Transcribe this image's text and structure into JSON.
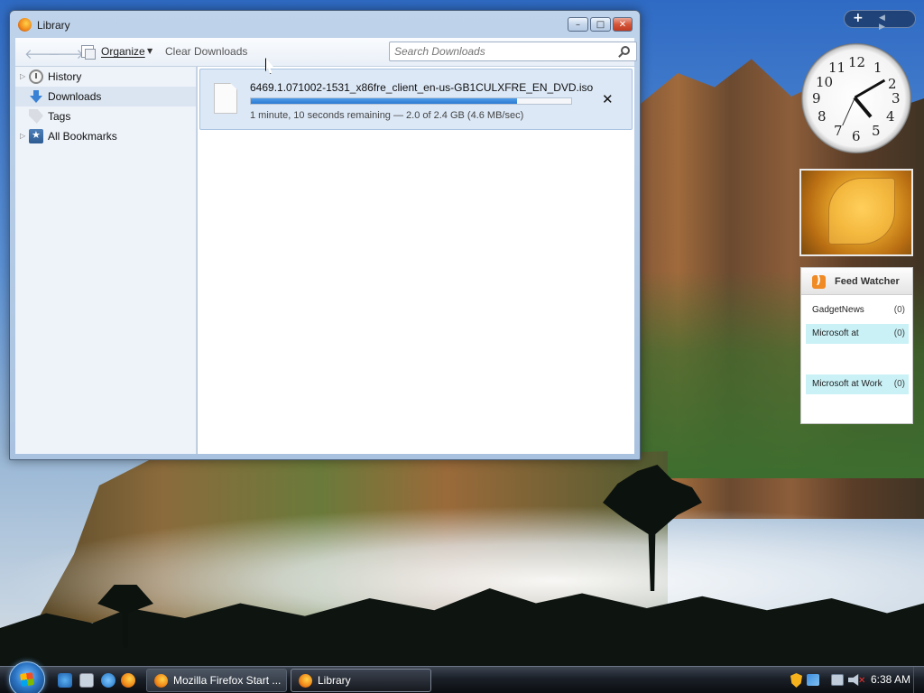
{
  "window": {
    "title": "Library",
    "controls": {
      "minimize": "–",
      "maximize": "□",
      "close": "✕"
    }
  },
  "toolbar": {
    "back_icon": "back-arrow-icon",
    "forward_icon": "forward-arrow-icon",
    "organize_label": "Organize",
    "clear_label": "Clear Downloads",
    "search_placeholder": "Search Downloads",
    "search_value": ""
  },
  "sidebar": {
    "items": [
      {
        "label": "History",
        "icon": "history-icon",
        "expandable": true,
        "selected": false
      },
      {
        "label": "Downloads",
        "icon": "downloads-icon",
        "expandable": false,
        "selected": true
      },
      {
        "label": "Tags",
        "icon": "tag-icon",
        "expandable": false,
        "selected": false
      },
      {
        "label": "All Bookmarks",
        "icon": "bookmarks-icon",
        "expandable": true,
        "selected": false
      }
    ]
  },
  "downloads": [
    {
      "filename": "6469.1.071002-1531_x86fre_client_en-us-GB1CULXFRE_EN_DVD.iso",
      "status": "1 minute, 10 seconds remaining — 2.0 of 2.4 GB (4.6 MB/sec)",
      "progress": 0.83,
      "cancel": "✕"
    }
  ],
  "gadgets": {
    "toolbar": {
      "add": "+",
      "arrows": "◀ ▶"
    },
    "clock": {
      "numbers": [
        "12",
        "1",
        "2",
        "3",
        "4",
        "5",
        "6",
        "7",
        "8",
        "9",
        "10",
        "11"
      ]
    },
    "feed": {
      "title": "Feed Watcher",
      "items": [
        {
          "label": "GadgetNews",
          "count": "(0)",
          "highlight": false
        },
        {
          "label": "Microsoft at",
          "count": "(0)",
          "highlight": true
        },
        {
          "label": "",
          "count": "",
          "highlight": false
        },
        {
          "label": "Microsoft at Work",
          "count": "(0)",
          "highlight": true
        }
      ]
    }
  },
  "taskbar": {
    "buttons": [
      {
        "label": "Mozilla Firefox Start ...",
        "active": false
      },
      {
        "label": "Library",
        "active": true
      }
    ],
    "time": "6:38 AM"
  }
}
